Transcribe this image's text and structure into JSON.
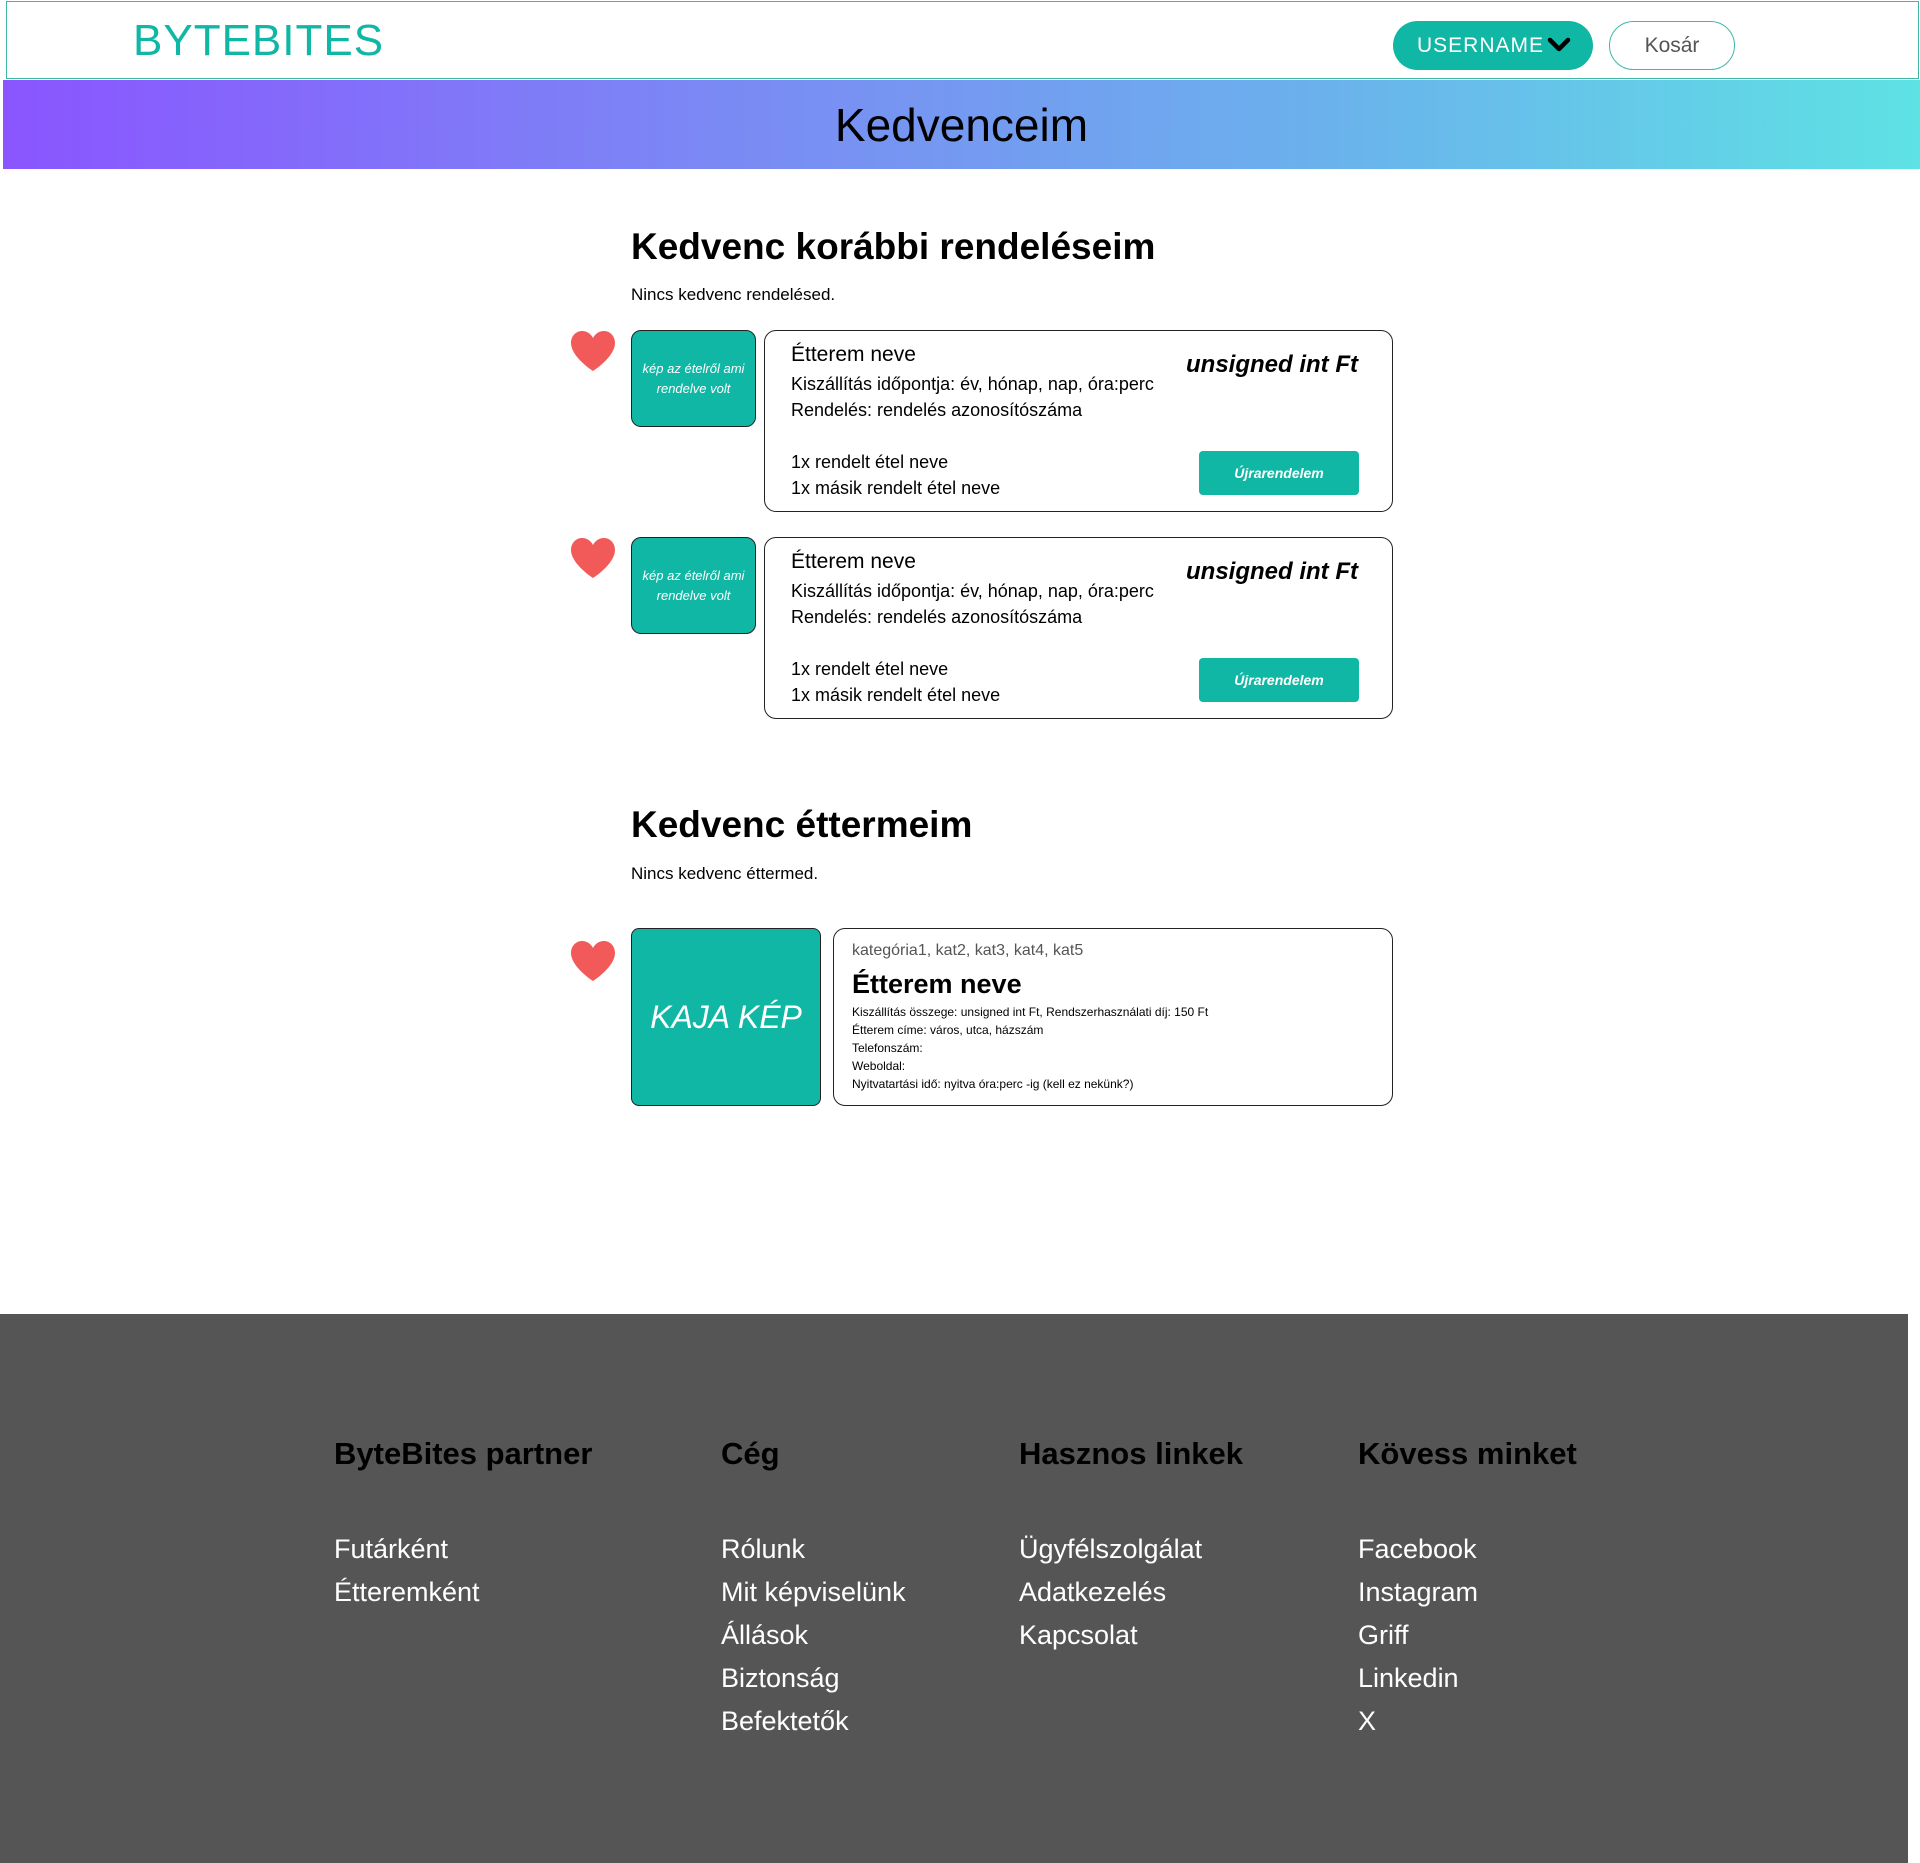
{
  "header": {
    "logo": "BYTEBITES",
    "username": "USERNAME",
    "cart_label": "Kosár"
  },
  "banner": {
    "title": "Kedvenceim"
  },
  "orders_section": {
    "title": "Kedvenc korábbi rendeléseim",
    "empty_note": "Nincs kedvenc rendelésed.",
    "orders": [
      {
        "image_text": "kép az ételről ami rendelve volt",
        "restaurant": "Étterem neve",
        "delivery": "Kiszállítás időpontja: év, hónap, nap, óra:perc",
        "order_id": "Rendelés: rendelés azonosítószáma",
        "price": "unsigned int Ft",
        "items": [
          "1x rendelt étel neve",
          "1x másik rendelt étel neve"
        ],
        "reorder_label": "Újrarendelem"
      },
      {
        "image_text": "kép az ételről ami rendelve volt",
        "restaurant": "Étterem neve",
        "delivery": "Kiszállítás időpontja: év, hónap, nap, óra:perc",
        "order_id": "Rendelés: rendelés azonosítószáma",
        "price": "unsigned int Ft",
        "items": [
          "1x rendelt étel neve",
          "1x másik rendelt étel neve"
        ],
        "reorder_label": "Újrarendelem"
      }
    ]
  },
  "restaurants_section": {
    "title": "Kedvenc éttermeim",
    "empty_note": "Nincs kedvenc éttermed.",
    "restaurant": {
      "image_text": "KAJA KÉP",
      "categories": "kategória1, kat2, kat3, kat4, kat5",
      "name": "Étterem neve",
      "info": [
        "Kiszállítás összege: unsigned int Ft, Rendszerhasználati díj: 150 Ft",
        "Étterem címe: város, utca, házszám",
        "Telefonszám:",
        "Weboldal:",
        "Nyitvatartási idő: nyitva óra:perc -ig (kell ez nekünk?)"
      ]
    }
  },
  "footer": {
    "columns": [
      {
        "title": "ByteBites partner",
        "links": [
          "Futárként",
          "Étteremként"
        ]
      },
      {
        "title": "Cég",
        "links": [
          "Rólunk",
          "Mit képviselünk",
          "Állások",
          "Biztonság",
          "Befektetők"
        ]
      },
      {
        "title": "Hasznos linkek",
        "links": [
          "Ügyfélszolgálat",
          "Adatkezelés",
          "Kapcsolat"
        ]
      },
      {
        "title": "Kövess minket",
        "links": [
          "Facebook",
          "Instagram",
          "Griff",
          "Linkedin",
          "X"
        ]
      }
    ]
  },
  "colors": {
    "accent": "#10b7a4",
    "heart": "#f25a5a",
    "footer_bg": "#555555",
    "gradient_start": "#8a55ff",
    "gradient_end": "#5ee2e4"
  },
  "icons": {
    "favorite": "heart-icon",
    "dropdown": "chevron-down-icon"
  }
}
